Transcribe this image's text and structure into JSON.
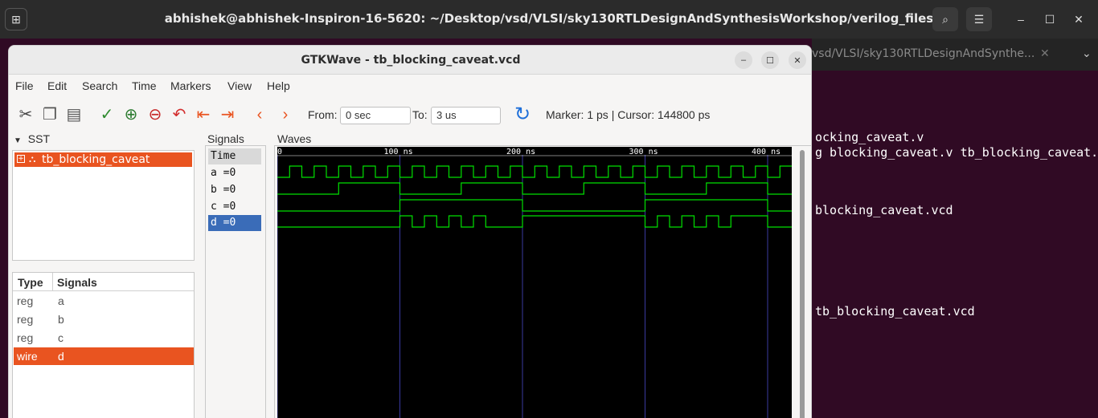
{
  "terminal": {
    "title": "abhishek@abhishek-Inspiron-16-5620: ~/Desktop/vsd/VLSI/sky130RTLDesignAndSynthesisWorkshop/verilog_files",
    "tab_label": "vsd/VLSI/sky130RTLDesignAndSynthe...",
    "lines": [
      "ocking_caveat.v",
      "g blocking_caveat.v tb_blocking_caveat.",
      " blocking_caveat.vcd",
      " tb_blocking_caveat.vcd"
    ]
  },
  "gtkwave": {
    "title": "GTKWave - tb_blocking_caveat.vcd",
    "menu": [
      "File",
      "Edit",
      "Search",
      "Time",
      "Markers",
      "View",
      "Help"
    ],
    "toolbar": {
      "from_label": "From:",
      "from_value": "0 sec",
      "to_label": "To:",
      "to_value": "3 us",
      "status": "Marker: 1 ps  |  Cursor: 144800 ps"
    },
    "sst": {
      "header": "SST",
      "tree_item": "tb_blocking_caveat"
    },
    "signal_table": {
      "col_type": "Type",
      "col_signals": "Signals",
      "rows": [
        {
          "type": "reg",
          "name": "a"
        },
        {
          "type": "reg",
          "name": "b"
        },
        {
          "type": "reg",
          "name": "c"
        },
        {
          "type": "wire",
          "name": "d"
        }
      ]
    },
    "signals_pane": {
      "header": "Signals",
      "items": [
        "Time",
        "a =0",
        "b =0",
        "c =0",
        "d =0"
      ]
    },
    "waves_pane": {
      "header": "Waves",
      "time_labels": [
        "0",
        "100 ns",
        "200 ns",
        "300 ns",
        "400 ns"
      ],
      "time_ns": [
        0,
        100,
        200,
        300,
        400
      ]
    }
  },
  "colors": {
    "accent": "#e95420",
    "wave": "#00e000",
    "selected_signal": "#3a6cb8",
    "terminal_bg": "#300a24"
  }
}
